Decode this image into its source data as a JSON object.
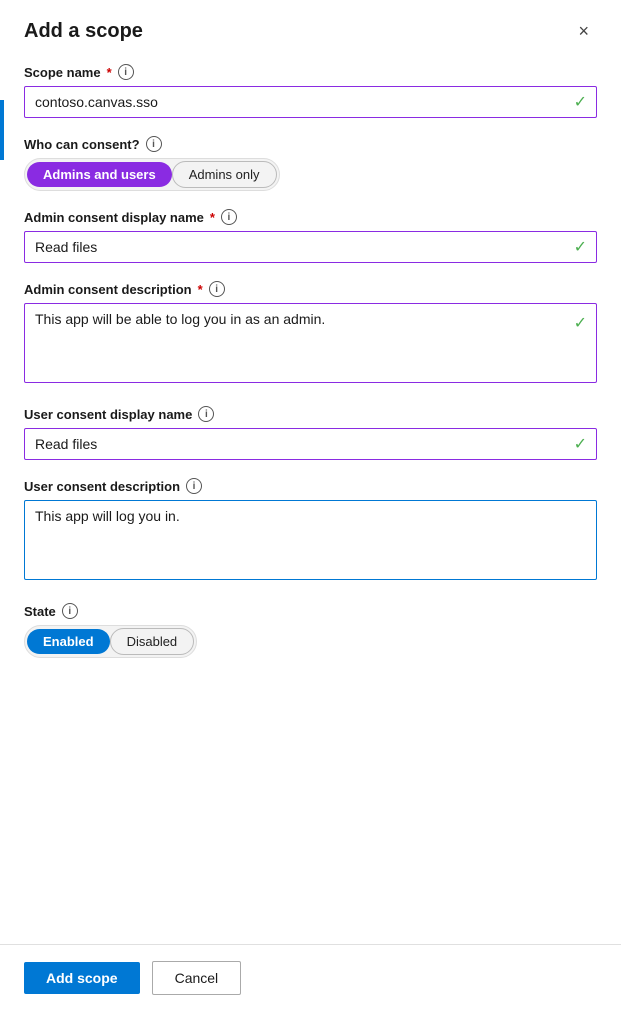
{
  "dialog": {
    "title": "Add a scope",
    "close_label": "×"
  },
  "fields": {
    "scope_name": {
      "label": "Scope name",
      "required": true,
      "value": "contoso.canvas.sso",
      "placeholder": ""
    },
    "who_can_consent": {
      "label": "Who can consent?",
      "options": [
        {
          "label": "Admins and users",
          "active": true,
          "style": "purple"
        },
        {
          "label": "Admins only",
          "active": false,
          "style": "none"
        }
      ]
    },
    "admin_consent_display_name": {
      "label": "Admin consent display name",
      "required": true,
      "value": "Read files",
      "placeholder": ""
    },
    "admin_consent_description": {
      "label": "Admin consent description",
      "required": true,
      "value": "This app will be able to log you in as an admin.",
      "placeholder": ""
    },
    "user_consent_display_name": {
      "label": "User consent display name",
      "required": false,
      "value": "Read files",
      "placeholder": ""
    },
    "user_consent_description": {
      "label": "User consent description",
      "required": false,
      "value": "This app will log you in.",
      "placeholder": ""
    },
    "state": {
      "label": "State",
      "options": [
        {
          "label": "Enabled",
          "active": true,
          "style": "blue"
        },
        {
          "label": "Disabled",
          "active": false,
          "style": "none"
        }
      ]
    }
  },
  "footer": {
    "add_scope_label": "Add scope",
    "cancel_label": "Cancel"
  },
  "icons": {
    "check": "✓",
    "info": "i",
    "close": "✕"
  }
}
